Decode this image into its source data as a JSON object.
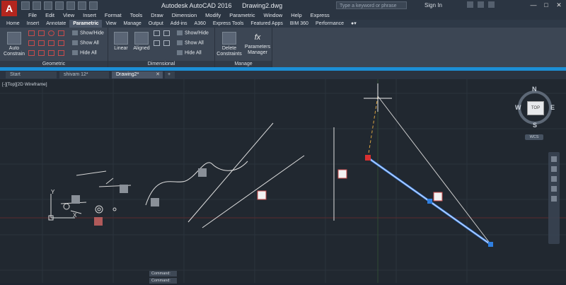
{
  "app": {
    "letter": "A",
    "title": "Autodesk AutoCAD 2016",
    "drawing_name": "Drawing2.dwg",
    "search_placeholder": "Type a keyword or phrase",
    "signin": "Sign In"
  },
  "menu": [
    "File",
    "Edit",
    "View",
    "Insert",
    "Format",
    "Tools",
    "Draw",
    "Dimension",
    "Modify",
    "Parametric",
    "Window",
    "Help",
    "Express"
  ],
  "ribbon_tabs": [
    {
      "label": "Home",
      "active": false
    },
    {
      "label": "Insert",
      "active": false
    },
    {
      "label": "Annotate",
      "active": false
    },
    {
      "label": "Parametric",
      "active": true
    },
    {
      "label": "View",
      "active": false
    },
    {
      "label": "Manage",
      "active": false
    },
    {
      "label": "Output",
      "active": false
    },
    {
      "label": "Add-ins",
      "active": false
    },
    {
      "label": "A360",
      "active": false
    },
    {
      "label": "Express Tools",
      "active": false
    },
    {
      "label": "Featured Apps",
      "active": false
    },
    {
      "label": "BIM 360",
      "active": false
    },
    {
      "label": "Performance",
      "active": false
    }
  ],
  "ribbon": {
    "geometric": {
      "title": "Geometric",
      "auto_constrain": "Auto Constrain",
      "show_hide": "Show/Hide",
      "show_all": "Show All",
      "hide_all": "Hide All"
    },
    "dimensional": {
      "title": "Dimensional",
      "linear": "Linear",
      "aligned": "Aligned",
      "show_hide": "Show/Hide",
      "show_all": "Show All",
      "hide_all": "Hide All"
    },
    "manage": {
      "title": "Manage",
      "delete_constraints": "Delete Constraints",
      "parameters_manager": "Parameters Manager"
    }
  },
  "doc_tabs": [
    {
      "label": "Start",
      "active": false
    },
    {
      "label": "shivam 12*",
      "active": false
    },
    {
      "label": "Drawing2*",
      "active": true
    }
  ],
  "viewport_label": "[-][Top][2D Wireframe]",
  "viewcube": {
    "n": "N",
    "s": "S",
    "e": "E",
    "w": "W",
    "face": "TOP",
    "wcs": "WCS"
  },
  "command": {
    "line1": "Command:",
    "line2": "Command:"
  },
  "colors": {
    "accent_blue": "#1c8fd6",
    "app_red": "#b3261e",
    "selected_line": "#4a8ff0"
  }
}
